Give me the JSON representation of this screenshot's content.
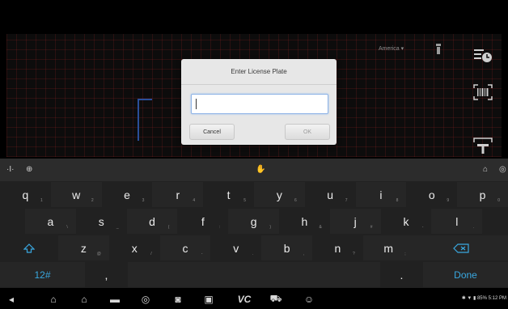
{
  "camera": {
    "region_label": "America ▾"
  },
  "dialog": {
    "title": "Enter License Plate",
    "input_value": "",
    "cancel_label": "Cancel",
    "ok_label": "OK"
  },
  "keyboard": {
    "row1": [
      {
        "k": "q",
        "s": "1"
      },
      {
        "k": "w",
        "s": "2"
      },
      {
        "k": "e",
        "s": "3"
      },
      {
        "k": "r",
        "s": "4"
      },
      {
        "k": "t",
        "s": "5"
      },
      {
        "k": "y",
        "s": "6"
      },
      {
        "k": "u",
        "s": "7"
      },
      {
        "k": "i",
        "s": "8"
      },
      {
        "k": "o",
        "s": "9"
      },
      {
        "k": "p",
        "s": "0"
      }
    ],
    "row2": [
      {
        "k": "a",
        "s": "\\"
      },
      {
        "k": "s",
        "s": "_"
      },
      {
        "k": "d",
        "s": "("
      },
      {
        "k": "f",
        "s": ":"
      },
      {
        "k": "g",
        "s": ")"
      },
      {
        "k": "h",
        "s": "&"
      },
      {
        "k": "j",
        "s": "#"
      },
      {
        "k": "k",
        "s": "-"
      },
      {
        "k": "l",
        "s": "."
      }
    ],
    "row3": [
      {
        "k": "z",
        "s": "@"
      },
      {
        "k": "x",
        "s": "/"
      },
      {
        "k": "c",
        "s": "-"
      },
      {
        "k": "v",
        "s": "."
      },
      {
        "k": "b",
        "s": ","
      },
      {
        "k": "n",
        "s": "?"
      },
      {
        "k": "m",
        "s": ";"
      }
    ],
    "symbols_label": "12#",
    "comma_label": ",",
    "period_label": ".",
    "done_label": "Done"
  },
  "status": {
    "text": "✱ ▼ ▮ 85% 5:12 PM"
  },
  "colors": {
    "accent": "#39a8e0",
    "input_focus": "#8fb3e6"
  }
}
